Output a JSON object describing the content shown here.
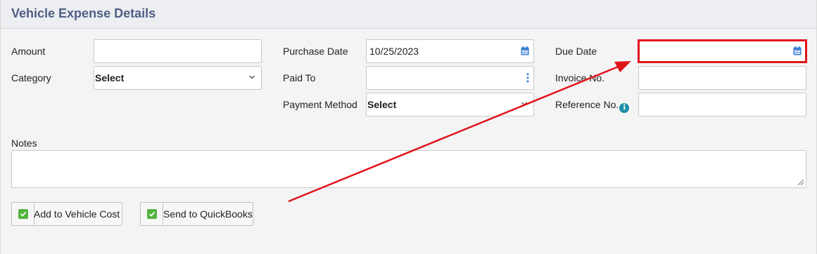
{
  "panel": {
    "title": "Vehicle Expense Details"
  },
  "fields": {
    "amount": {
      "label": "Amount",
      "value": ""
    },
    "category": {
      "label": "Category",
      "value": "Select"
    },
    "purchase_date": {
      "label": "Purchase Date",
      "value": "10/25/2023"
    },
    "paid_to": {
      "label": "Paid To",
      "value": ""
    },
    "payment_method": {
      "label": "Payment Method",
      "value": "Select"
    },
    "due_date": {
      "label": "Due Date",
      "value": ""
    },
    "invoice_no": {
      "label": "Invoice No.",
      "value": ""
    },
    "reference_no": {
      "label": "Reference No.",
      "value": ""
    },
    "notes": {
      "label": "Notes",
      "value": ""
    }
  },
  "options": {
    "add_to_vehicle_cost": {
      "label": "Add to Vehicle Cost",
      "checked": true
    },
    "send_to_quickbooks": {
      "label": "Send to QuickBooks",
      "checked": true
    }
  },
  "colors": {
    "title": "#4f5f84",
    "checkbox": "#54b340",
    "annotation": "#e0151b",
    "info": "#1a8fa8",
    "calendar": "#3a7bd5"
  },
  "icons": {
    "calendar": "calendar-icon",
    "more": "more-vertical-icon",
    "chevron": "chevron-down-icon",
    "info": "info-icon",
    "check": "check-icon"
  }
}
